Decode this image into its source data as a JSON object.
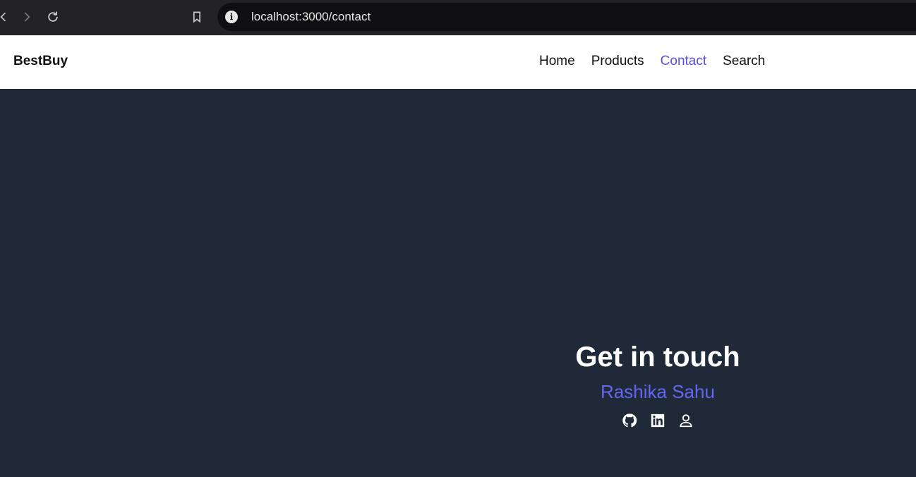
{
  "browser": {
    "url": "localhost:3000/contact"
  },
  "header": {
    "brand": "BestBuy",
    "nav": [
      {
        "label": "Home"
      },
      {
        "label": "Products"
      },
      {
        "label": "Contact"
      },
      {
        "label": "Search"
      }
    ],
    "active": "Contact"
  },
  "contact": {
    "title": "Get in touch",
    "name": "Rashika Sahu",
    "socials": [
      "github-icon",
      "linkedin-icon",
      "user-icon"
    ]
  },
  "colors": {
    "accent": "#6366f1",
    "background": "#202938"
  }
}
